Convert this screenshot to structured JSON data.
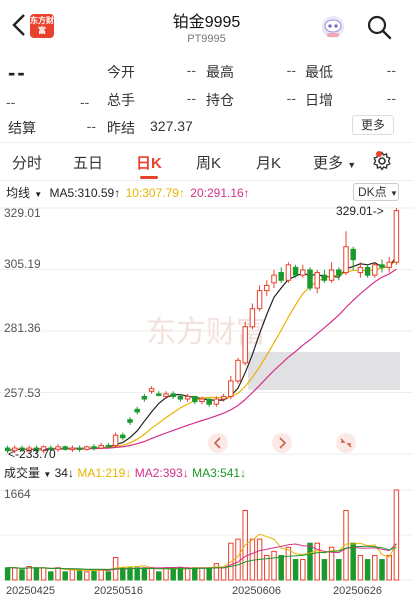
{
  "header": {
    "logo_text": "东方财富",
    "title": "铂金9995",
    "subtitle": "PT9995"
  },
  "quote": {
    "price": "--",
    "change": "--",
    "change_pct": "--",
    "open_label": "今开",
    "open_value": "--",
    "high_label": "最高",
    "high_value": "--",
    "low_label": "最低",
    "low_value": "--",
    "volume_label": "总手",
    "volume_value": "--",
    "position_label": "持仓",
    "position_value": "--",
    "daily_inc_label": "日增",
    "daily_inc_value": "--",
    "settle_label": "结算",
    "settle_value": "--",
    "prev_settle_label": "昨结",
    "prev_settle_value": "327.37",
    "more_label": "更多"
  },
  "tabs": [
    {
      "label": "分时",
      "active": false
    },
    {
      "label": "五日",
      "active": false
    },
    {
      "label": "日K",
      "active": true
    },
    {
      "label": "周K",
      "active": false
    },
    {
      "label": "月K",
      "active": false
    },
    {
      "label": "更多",
      "active": false
    }
  ],
  "ma": {
    "mode": "均线",
    "ma5": "MA5:310.59↑",
    "ma10": "10:307.79↑",
    "ma20": "20:291.16↑",
    "dk_label": "DK点"
  },
  "colors": {
    "up": "#e8412c",
    "down": "#1a9a2c",
    "ma5": "#222222",
    "ma10": "#e8b400",
    "ma20": "#d6308a",
    "band": "#d9d9dd"
  },
  "price_axis": {
    "labels": [
      "329.01",
      "305.19",
      "281.36",
      "257.53"
    ],
    "max_marker": "329.01",
    "min_marker": "233.70"
  },
  "nav_icons": [
    "chevron-left-icon",
    "chevron-right-icon",
    "collapse-icon"
  ],
  "volume": {
    "label": "成交量",
    "value": "34↓",
    "ma1": "MA1:219↓",
    "ma2": "MA2:393↓",
    "ma3": "MA3:541↓",
    "axis_top": "1664"
  },
  "dates": [
    "20250425",
    "20250516",
    "20250606",
    "20250626"
  ],
  "watermark": "东方财富",
  "chart_data": {
    "type": "candlestick",
    "title": "铂金9995 日K",
    "ylim": [
      233.7,
      329.01
    ],
    "candles": [
      {
        "o": 236,
        "c": 235,
        "h": 237,
        "l": 234,
        "up": false
      },
      {
        "o": 235,
        "c": 236,
        "h": 237,
        "l": 234,
        "up": true
      },
      {
        "o": 236,
        "c": 235.5,
        "h": 237,
        "l": 234.5,
        "up": false
      },
      {
        "o": 235,
        "c": 236,
        "h": 237,
        "l": 233.7,
        "up": true
      },
      {
        "o": 236,
        "c": 235,
        "h": 237,
        "l": 234,
        "up": false
      },
      {
        "o": 235,
        "c": 236.5,
        "h": 237,
        "l": 234,
        "up": true
      },
      {
        "o": 236,
        "c": 235.5,
        "h": 237,
        "l": 235,
        "up": false
      },
      {
        "o": 235.5,
        "c": 236.5,
        "h": 237.5,
        "l": 234.5,
        "up": true
      },
      {
        "o": 236.5,
        "c": 235.5,
        "h": 237,
        "l": 235,
        "up": false
      },
      {
        "o": 235.5,
        "c": 236,
        "h": 237,
        "l": 234.5,
        "up": true
      },
      {
        "o": 236,
        "c": 235.5,
        "h": 237,
        "l": 234.5,
        "up": false
      },
      {
        "o": 235.5,
        "c": 236.5,
        "h": 237,
        "l": 235,
        "up": true
      },
      {
        "o": 236.5,
        "c": 236,
        "h": 237.5,
        "l": 235,
        "up": false
      },
      {
        "o": 236,
        "c": 237,
        "h": 238,
        "l": 235.5,
        "up": true
      },
      {
        "o": 237,
        "c": 236.5,
        "h": 238,
        "l": 236,
        "up": false
      },
      {
        "o": 237,
        "c": 241,
        "h": 242,
        "l": 236.5,
        "up": true
      },
      {
        "o": 241,
        "c": 240,
        "h": 242,
        "l": 239,
        "up": false
      },
      {
        "o": 247,
        "c": 246,
        "h": 248,
        "l": 245,
        "up": false
      },
      {
        "o": 251,
        "c": 250,
        "h": 252,
        "l": 249,
        "up": false
      },
      {
        "o": 256,
        "c": 255,
        "h": 257,
        "l": 254,
        "up": false
      },
      {
        "o": 258,
        "c": 259,
        "h": 260,
        "l": 257,
        "up": true
      },
      {
        "o": 257,
        "c": 256.5,
        "h": 258,
        "l": 256,
        "up": false
      },
      {
        "o": 256,
        "c": 257,
        "h": 258,
        "l": 255,
        "up": true
      },
      {
        "o": 257,
        "c": 256,
        "h": 258,
        "l": 255,
        "up": false
      },
      {
        "o": 256,
        "c": 255,
        "h": 257,
        "l": 254,
        "up": false
      },
      {
        "o": 255,
        "c": 256,
        "h": 257,
        "l": 254,
        "up": true
      },
      {
        "o": 256,
        "c": 254,
        "h": 256,
        "l": 253,
        "up": false
      },
      {
        "o": 254,
        "c": 255,
        "h": 256,
        "l": 253,
        "up": true
      },
      {
        "o": 255,
        "c": 253,
        "h": 255,
        "l": 252,
        "up": false
      },
      {
        "o": 253,
        "c": 255,
        "h": 256,
        "l": 252,
        "up": true
      },
      {
        "o": 255,
        "c": 256,
        "h": 257,
        "l": 254,
        "up": true
      },
      {
        "o": 256,
        "c": 262,
        "h": 264,
        "l": 255,
        "up": true
      },
      {
        "o": 262,
        "c": 270,
        "h": 271,
        "l": 261,
        "up": true
      },
      {
        "o": 269,
        "c": 283,
        "h": 285,
        "l": 268,
        "up": true
      },
      {
        "o": 283,
        "c": 290,
        "h": 292,
        "l": 282,
        "up": true
      },
      {
        "o": 290,
        "c": 297,
        "h": 299,
        "l": 289,
        "up": true
      },
      {
        "o": 297,
        "c": 299,
        "h": 301,
        "l": 295,
        "up": true
      },
      {
        "o": 300,
        "c": 303,
        "h": 305,
        "l": 298,
        "up": true
      },
      {
        "o": 304,
        "c": 301,
        "h": 306,
        "l": 300,
        "up": false
      },
      {
        "o": 301,
        "c": 307,
        "h": 308,
        "l": 300,
        "up": true
      },
      {
        "o": 306,
        "c": 303,
        "h": 307,
        "l": 302,
        "up": false
      },
      {
        "o": 303,
        "c": 305,
        "h": 307,
        "l": 302,
        "up": true
      },
      {
        "o": 305,
        "c": 298,
        "h": 306,
        "l": 297,
        "up": false
      },
      {
        "o": 298,
        "c": 304,
        "h": 305,
        "l": 296,
        "up": true
      },
      {
        "o": 303,
        "c": 301,
        "h": 305,
        "l": 300,
        "up": false
      },
      {
        "o": 301,
        "c": 305,
        "h": 308,
        "l": 300,
        "up": true
      },
      {
        "o": 305,
        "c": 303,
        "h": 306,
        "l": 301,
        "up": false
      },
      {
        "o": 304,
        "c": 314,
        "h": 320,
        "l": 303,
        "up": true
      },
      {
        "o": 313,
        "c": 309,
        "h": 314,
        "l": 305,
        "up": false
      },
      {
        "o": 304,
        "c": 306,
        "h": 308,
        "l": 302,
        "up": true
      },
      {
        "o": 306,
        "c": 303,
        "h": 307,
        "l": 302,
        "up": false
      },
      {
        "o": 303,
        "c": 307,
        "h": 308,
        "l": 302,
        "up": true
      },
      {
        "o": 307,
        "c": 306,
        "h": 309,
        "l": 304,
        "up": false
      },
      {
        "o": 306,
        "c": 308,
        "h": 310,
        "l": 304,
        "up": true
      },
      {
        "o": 308,
        "c": 328,
        "h": 329.01,
        "l": 307,
        "up": true
      }
    ],
    "volume_max": 1664
  }
}
